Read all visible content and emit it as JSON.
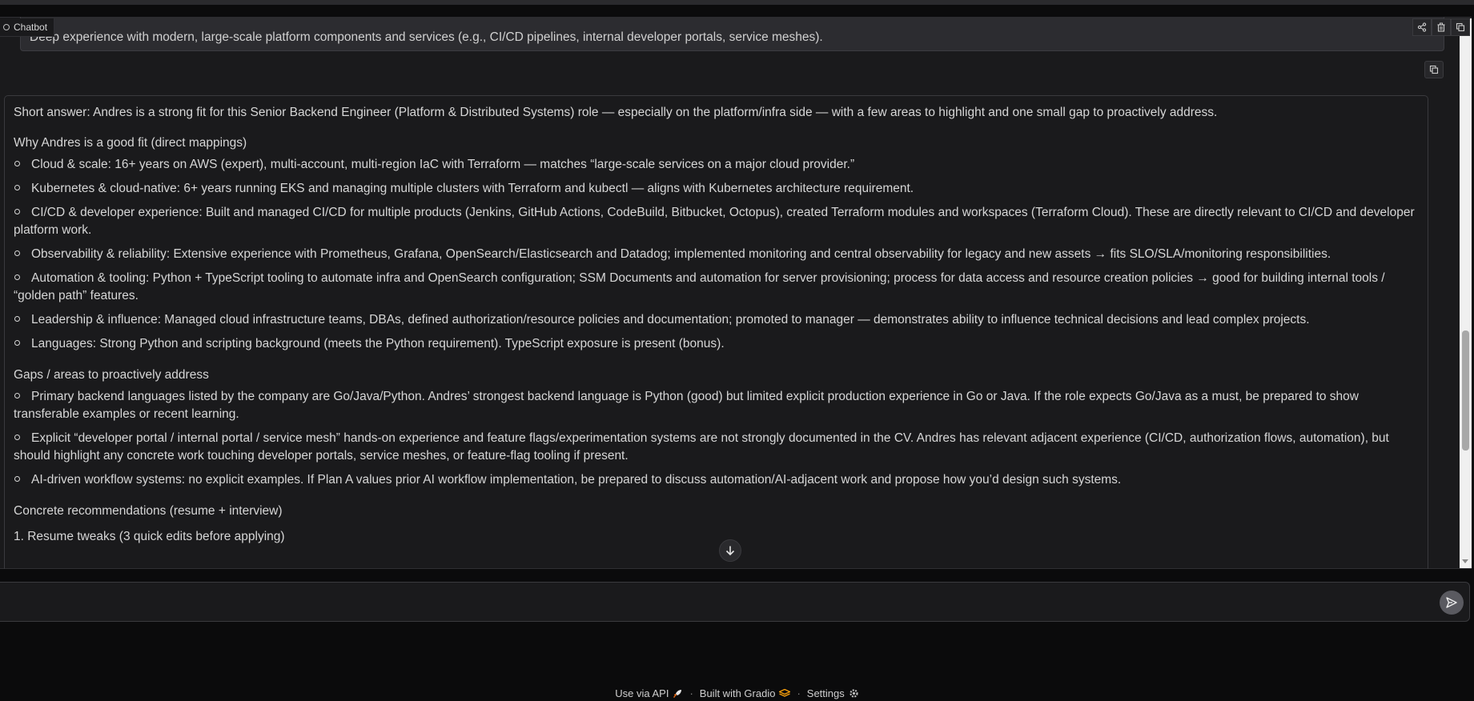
{
  "chatbot": {
    "label": "Chatbot",
    "user_message_tail": "Deep experience with modern, large-scale platform components and services (e.g., CI/CD pipelines, internal developer portals, service meshes).",
    "bot_message": {
      "intro": "Short answer: Andres is a strong fit for this Senior Backend Engineer (Platform & Distributed Systems) role — especially on the platform/infra side — with a few areas to highlight and one small gap to proactively address.",
      "fit_heading": "Why Andres is a good fit (direct mappings)",
      "fit_items": [
        "Cloud & scale: 16+ years on AWS (expert), multi-account, multi-region IaC with Terraform — matches “large-scale services on a major cloud provider.”",
        "Kubernetes & cloud-native: 6+ years running EKS and managing multiple clusters with Terraform and kubectl — aligns with Kubernetes architecture requirement.",
        "CI/CD & developer experience: Built and managed CI/CD for multiple products (Jenkins, GitHub Actions, CodeBuild, Bitbucket, Octopus), created Terraform modules and workspaces (Terraform Cloud). These are directly relevant to CI/CD and developer platform work.",
        "Observability & reliability: Extensive experience with Prometheus, Grafana, OpenSearch/Elasticsearch and Datadog; implemented monitoring and central observability for legacy and new assets → fits SLO/SLA/monitoring responsibilities.",
        "Automation & tooling: Python + TypeScript tooling to automate infra and OpenSearch configuration; SSM Documents and automation for server provisioning; process for data access and resource creation policies → good for building internal tools / “golden path” features.",
        "Leadership & influence: Managed cloud infrastructure teams, DBAs, defined authorization/resource policies and documentation; promoted to manager — demonstrates ability to influence technical decisions and lead complex projects.",
        "Languages: Strong Python and scripting background (meets the Python requirement). TypeScript exposure is present (bonus)."
      ],
      "gaps_heading": "Gaps / areas to proactively address",
      "gap_items": [
        "Primary backend languages listed by the company are Go/Java/Python. Andres’ strongest backend language is Python (good) but limited explicit production experience in Go or Java. If the role expects Go/Java as a must, be prepared to show transferable examples or recent learning.",
        "Explicit “developer portal / internal portal / service mesh” hands-on experience and feature flags/experimentation systems are not strongly documented in the CV. Andres has relevant adjacent experience (CI/CD, authorization flows, automation), but should highlight any concrete work touching developer portals, service meshes, or feature-flag tooling if present.",
        "AI-driven workflow systems: no explicit examples. If Plan A values prior AI workflow implementation, be prepared to discuss automation/AI-adjacent work and propose how you’d design such systems."
      ],
      "recs_heading": "Concrete recommendations (resume + interview)",
      "recs_first": "1. Resume tweaks (3 quick edits before applying)"
    }
  },
  "input": {
    "value": "",
    "placeholder": ""
  },
  "footer": {
    "api": "Use via API",
    "built": "Built with Gradio",
    "settings": "Settings",
    "separator": "·"
  },
  "colors": {
    "background": "#0b0b0c",
    "panel": "#1a1a1c",
    "user_bubble": "#2c2c30",
    "gradio_orange": "#f59e0b"
  }
}
